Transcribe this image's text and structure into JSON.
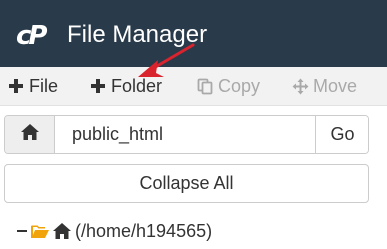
{
  "header": {
    "logo_text": "cP",
    "title": "File Manager",
    "logo_icon": "cpanel-logo-icon"
  },
  "toolbar": {
    "buttons": [
      {
        "label": "File",
        "icon": "plus-icon",
        "enabled": true
      },
      {
        "label": "Folder",
        "icon": "plus-icon",
        "enabled": true
      },
      {
        "label": "Copy",
        "icon": "copy-icon",
        "enabled": false
      },
      {
        "label": "Move",
        "icon": "move-icon",
        "enabled": false
      }
    ]
  },
  "pathbar": {
    "home_icon": "home-icon",
    "path_value": "public_html",
    "go_label": "Go"
  },
  "collapse_all_label": "Collapse All",
  "tree": {
    "root_label": "(/home/h194565)",
    "icons": [
      "minus-icon",
      "folder-open-icon",
      "home-icon"
    ]
  },
  "colors": {
    "header_bg": "#293a4a",
    "toolbar_bg": "#f2f2f2",
    "folder": "#f0a30a",
    "arrow": "#d9232d"
  }
}
